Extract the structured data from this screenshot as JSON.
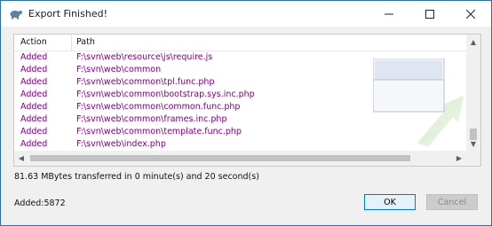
{
  "window": {
    "title": "Export Finished!"
  },
  "window_controls": {
    "minimize": "—",
    "maximize": "☐",
    "close": "✕"
  },
  "list": {
    "columns": [
      "Action",
      "Path"
    ],
    "rows": [
      {
        "action": "Added",
        "path": "F:\\svn\\web\\resource\\js\\require.js"
      },
      {
        "action": "Added",
        "path": "F:\\svn\\web\\common"
      },
      {
        "action": "Added",
        "path": "F:\\svn\\web\\common\\tpl.func.php"
      },
      {
        "action": "Added",
        "path": "F:\\svn\\web\\common\\bootstrap.sys.inc.php"
      },
      {
        "action": "Added",
        "path": "F:\\svn\\web\\common\\common.func.php"
      },
      {
        "action": "Added",
        "path": "F:\\svn\\web\\common\\frames.inc.php"
      },
      {
        "action": "Added",
        "path": "F:\\svn\\web\\common\\template.func.php"
      },
      {
        "action": "Added",
        "path": "F:\\svn\\web\\index.php"
      }
    ]
  },
  "status": {
    "transfer": "81.63 MBytes transferred in 0 minute(s) and 20 second(s)",
    "added": "Added:5872"
  },
  "buttons": {
    "ok": "OK",
    "cancel": "Cancel"
  },
  "colors": {
    "row_text": "#800080",
    "accent": "#0078d7"
  }
}
